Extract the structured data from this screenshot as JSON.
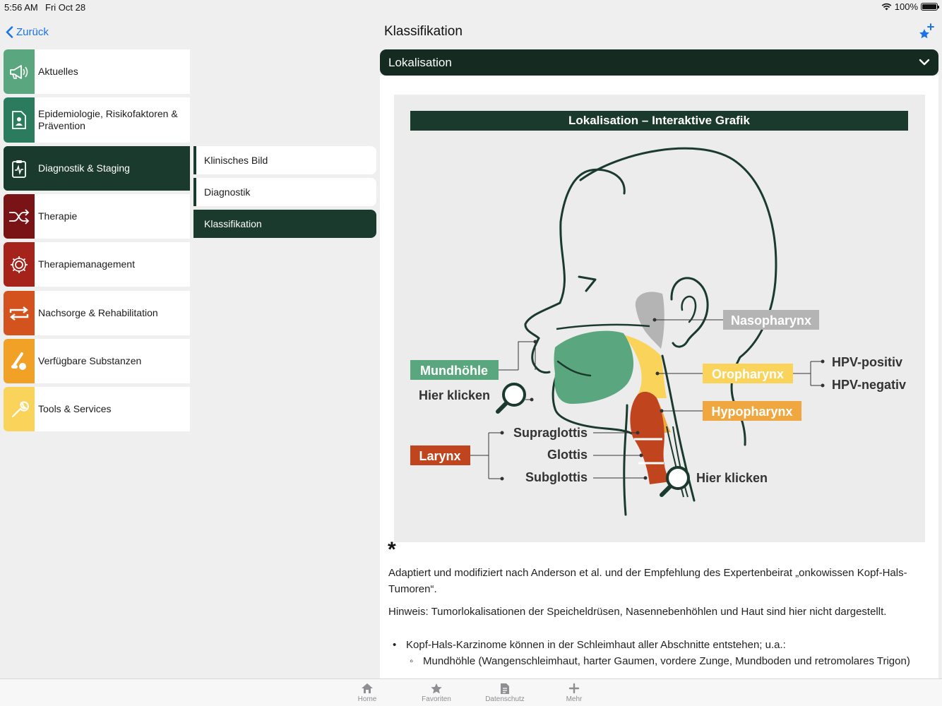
{
  "status": {
    "time": "5:56 AM",
    "date": "Fri Oct 28",
    "battery": "100%"
  },
  "nav": {
    "back_label": "Zurück",
    "title": "Klassifikation"
  },
  "sidebar": {
    "items": [
      {
        "label": "Aktuelles",
        "icon": "megaphone-icon",
        "color": "#5aa77f"
      },
      {
        "label": "Epidemiologie, Risikofaktoren & Prävention",
        "icon": "document-person-icon",
        "color": "#2b7c5e"
      },
      {
        "label": "Diagnostik & Staging",
        "icon": "clipboard-pulse-icon",
        "color": "#1b3a2e",
        "active": true
      },
      {
        "label": "Therapie",
        "icon": "shuffle-icon",
        "color": "#7a1316"
      },
      {
        "label": "Therapiemanagement",
        "icon": "gear-icon",
        "color": "#a6231c"
      },
      {
        "label": "Nachsorge & Rehabilitation",
        "icon": "repeat-icon",
        "color": "#d4521d"
      },
      {
        "label": "Verfügbare Substanzen",
        "icon": "pills-icon",
        "color": "#f1a126"
      },
      {
        "label": "Tools & Services",
        "icon": "wrench-icon",
        "color": "#f9d35a"
      }
    ]
  },
  "submenu": {
    "items": [
      {
        "label": "Klinisches Bild"
      },
      {
        "label": "Diagnostik"
      },
      {
        "label": "Klassifikation",
        "active": true
      }
    ]
  },
  "accordion": {
    "title": "Lokalisation"
  },
  "figure": {
    "title": "Lokalisation – Interaktive Grafik",
    "labels": {
      "nasopharynx": "Nasopharynx",
      "oropharynx": "Oropharynx",
      "hypopharynx": "Hypopharynx",
      "mundhoehle": "Mundhöhle",
      "larynx": "Larynx",
      "hpv_pos": "HPV-positiv",
      "hpv_neg": "HPV-negativ",
      "supraglottis": "Supraglottis",
      "glottis": "Glottis",
      "subglottis": "Subglottis",
      "click_left": "Hier klicken",
      "click_right": "Hier klicken"
    },
    "colors": {
      "green": "#5aa77f",
      "gray": "#b4b4b4",
      "yellow": "#f9d35a",
      "orange": "#f1a740",
      "red": "#c0451f"
    }
  },
  "text": {
    "asterisk": "*",
    "source": "Adaptiert und modifiziert nach Anderson et al. und der Empfehlung des Expertenbeirat „onkowissen Kopf-Hals-Tumoren“.",
    "note": "Hinweis: Tumorlokalisationen der Speicheldrüsen, Nasennebenhöhlen und Haut sind hier nicht dargestellt.",
    "bullet1": "Kopf-Hals-Karzinome können in der Schleimhaut aller Abschnitte entstehen; u.a.:",
    "bullet2": "Mundhöhle (Wangenschleimhaut, harter Gaumen, vordere Zunge, Mundboden und retromolares Trigon)"
  },
  "tabbar": {
    "items": [
      {
        "label": "Home",
        "icon": "house-icon"
      },
      {
        "label": "Favoriten",
        "icon": "star-icon"
      },
      {
        "label": "Datenschutz",
        "icon": "document-icon"
      },
      {
        "label": "Mehr",
        "icon": "plus-icon"
      }
    ]
  }
}
